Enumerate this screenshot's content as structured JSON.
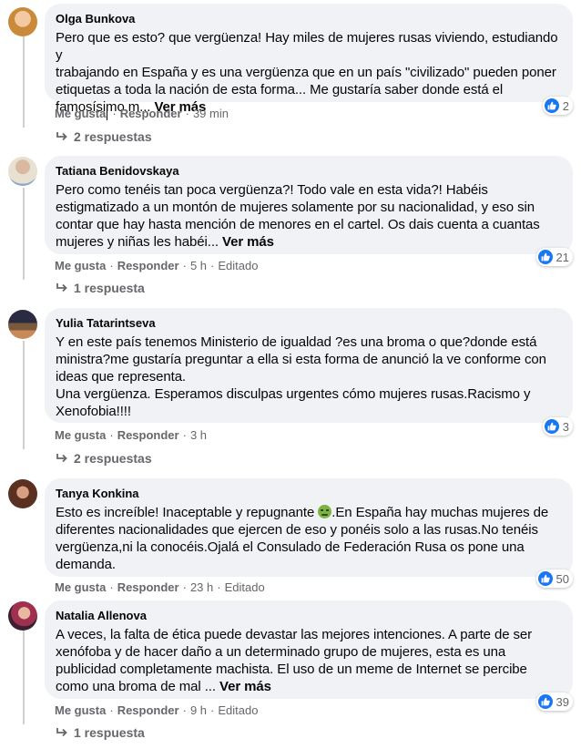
{
  "colors": {
    "like": "#1877f2",
    "muted": "#65676b",
    "bubble": "#f0f2f5"
  },
  "actions": {
    "like": "Me gusta",
    "reply": "Responder",
    "more": "Ver más",
    "edited": "Editado",
    "dot": "·"
  },
  "comments": [
    {
      "author": "Olga Bunkova",
      "text": "Pero que es esto? que vergüenza! Hay miles de mujeres rusas viviendo, estudiando y\ntrabajando en España y es una vergüenza que en un país \"civilizado\" pueden poner\netiquetas a toda la nación de esta forma... Me gustaría saber donde está el\nfamosísimo m...",
      "time": "39 min",
      "reactions": "2",
      "replies": "2 respuestas"
    },
    {
      "author": "Tatiana Benidovskaya",
      "text": "Pero como tenéis tan poca vergüenza?! Todo vale en esta vida?! Habéis\nestigmatizado a un montón de mujeres solamente por su nacionalidad, y eso sin\ncontar que hay hasta mención de menores en el cartel. Os dais cuenta a cuantas\nmujeres y niñas les habéi...",
      "time": "5 h",
      "reactions": "21",
      "replies": "1 respuesta"
    },
    {
      "author": "Yulia Tatarintseva",
      "text": "Y en este país tenemos Ministerio de igualdad ?es una broma o que?donde está\nministra?me gustaría preguntar a ella si esta forma de anunció la ve conforme con\nideas que representa.\nUna vergüenza. Esperamos disculpas urgentes cómo mujeres rusas.Racismo y\nXenofobia!!!!",
      "time": "3 h",
      "reactions": "3",
      "replies": "2 respuestas"
    },
    {
      "author": "Tanya Konkina",
      "text_a": "Esto es increíble! Inaceptable y repugnante ",
      "text_b": ".En España hay muchas mujeres de\ndiferentes nacionalidades que ejercen de eso y ponéis solo a las rusas.No tenéis\nvergüenza,ni la conocéis.Ojalá el Consulado de Federación Rusa os pone una\ndemanda.",
      "time": "23 h",
      "reactions": "50"
    },
    {
      "author": "Natalia Allenova",
      "text": "A veces, la falta de ética puede devastar las mejores intenciones. A parte de ser\nxenófoba y de hacer daño a un determinado grupo de mujeres, esta es una\npublicidad completamente machista. El uso de un meme de Internet se percibe\ncomo una broma de mal ...",
      "time": "9 h",
      "reactions": "39",
      "replies": "1 respuesta"
    }
  ]
}
